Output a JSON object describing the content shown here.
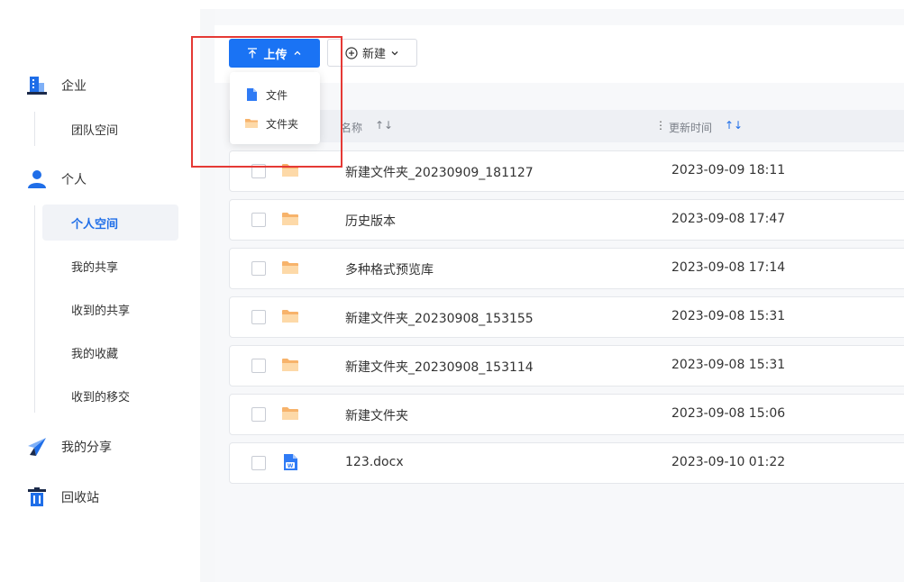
{
  "sidebar": {
    "groups": [
      {
        "label": "企业",
        "icon": "building-icon"
      },
      {
        "label": "个人",
        "icon": "person-icon"
      },
      {
        "label": "我的分享",
        "icon": "paper-plane-icon"
      },
      {
        "label": "回收站",
        "icon": "trash-icon"
      }
    ],
    "enterprise_sub": [
      {
        "label": "团队空间"
      }
    ],
    "personal_sub": [
      {
        "label": "个人空间",
        "active": true
      },
      {
        "label": "我的共享"
      },
      {
        "label": "收到的共享"
      },
      {
        "label": "我的收藏"
      },
      {
        "label": "收到的移交"
      }
    ]
  },
  "toolbar": {
    "upload_label": "上传",
    "new_label": "新建"
  },
  "upload_menu": {
    "items": [
      {
        "label": "文件",
        "icon": "file-icon"
      },
      {
        "label": "文件夹",
        "icon": "folder-icon"
      }
    ]
  },
  "table": {
    "columns": {
      "name": "名称",
      "updated": "更新时间",
      "sort_glyph": "↑↓"
    },
    "rows": [
      {
        "name": "新建文件夹_20230909_181127",
        "updated": "2023-09-09 18:11",
        "type": "folder"
      },
      {
        "name": "历史版本",
        "updated": "2023-09-08 17:47",
        "type": "folder"
      },
      {
        "name": "多种格式预览库",
        "updated": "2023-09-08 17:14",
        "type": "folder"
      },
      {
        "name": "新建文件夹_20230908_153155",
        "updated": "2023-09-08 15:31",
        "type": "folder"
      },
      {
        "name": "新建文件夹_20230908_153114",
        "updated": "2023-09-08 15:31",
        "type": "folder"
      },
      {
        "name": "新建文件夹",
        "updated": "2023-09-08 15:06",
        "type": "folder"
      },
      {
        "name": "123.docx",
        "updated": "2023-09-10 01:22",
        "type": "word"
      }
    ]
  },
  "colors": {
    "primary": "#1a73f4",
    "active_text": "#1f6ee8",
    "highlight": "#e53935",
    "folder": "#f7b36b"
  }
}
